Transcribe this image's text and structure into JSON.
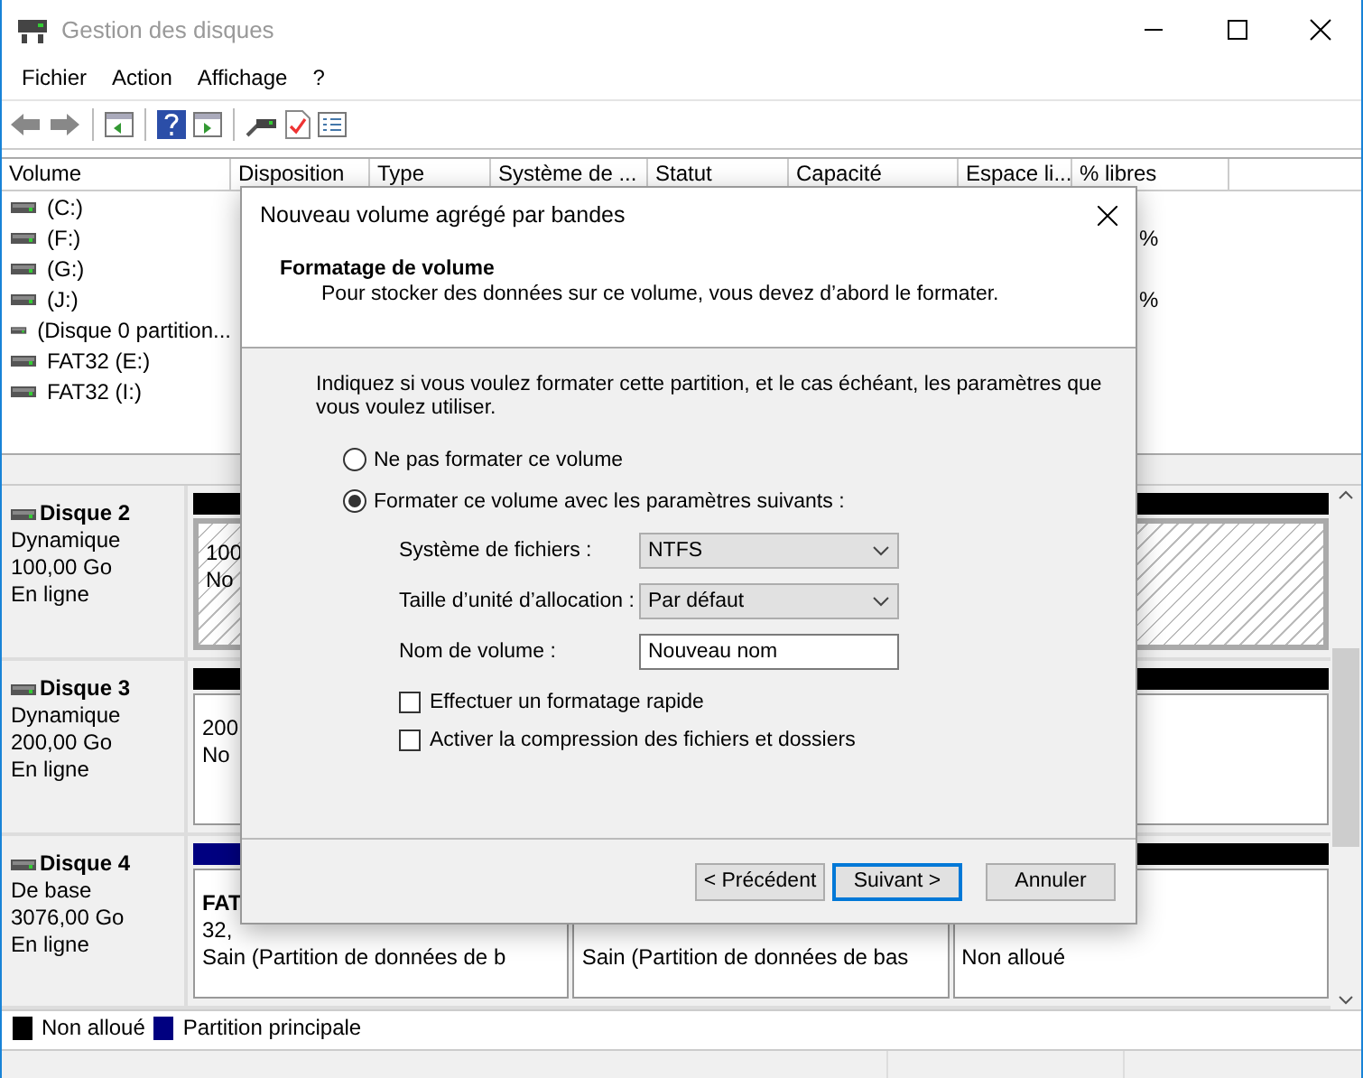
{
  "window": {
    "title": "Gestion des disques"
  },
  "menu": [
    "Fichier",
    "Action",
    "Affichage",
    "?"
  ],
  "volume_table": {
    "columns": [
      "Volume",
      "Disposition",
      "Type",
      "Système de ...",
      "Statut",
      "Capacité",
      "Espace li...",
      "% libres"
    ],
    "rows": [
      {
        "volume": "(C:)"
      },
      {
        "volume": "(F:)",
        "column_8": "%"
      },
      {
        "volume": "(G:)"
      },
      {
        "volume": "(J:)",
        "column_8": "%"
      },
      {
        "volume": "(Disque 0 partition..."
      },
      {
        "volume": "FAT32 (E:)"
      },
      {
        "volume": "FAT32 (I:)"
      }
    ]
  },
  "disks": [
    {
      "name": "Disque 2",
      "type": "Dynamique",
      "size": "100,00 Go",
      "status": "En ligne",
      "partitions": [
        {
          "kind": "unallocated",
          "selected": true,
          "lines": [
            "100",
            "No"
          ]
        }
      ]
    },
    {
      "name": "Disque 3",
      "type": "Dynamique",
      "size": "200,00 Go",
      "status": "En ligne",
      "partitions": [
        {
          "kind": "unallocated",
          "selected": false,
          "lines": [
            "200",
            "No"
          ]
        }
      ]
    },
    {
      "name": "Disque 4",
      "type": "De base",
      "size": "3076,00 Go",
      "status": "En ligne",
      "partitions": [
        {
          "kind": "primary",
          "selected": false,
          "name": "FAT",
          "lines": [
            "32,",
            "Sain (Partition de données de b"
          ]
        },
        {
          "selected": false,
          "lines": [
            "Sain (Partition de données de bas"
          ]
        },
        {
          "kind": "unallocated",
          "selected": false,
          "lines": [
            "Non alloué"
          ]
        }
      ]
    }
  ],
  "legend": [
    {
      "label": "Non alloué",
      "color": "#000000"
    },
    {
      "label": "Partition principale",
      "color": "#000080"
    }
  ],
  "dialog": {
    "title": "Nouveau volume agrégé par bandes",
    "heading": "Formatage de volume",
    "subheading": "Pour stocker des données sur ce volume, vous devez d’abord le formater.",
    "intro": "Indiquez si vous voulez formater cette partition, et le cas échéant, les paramètres que vous voulez utiliser.",
    "options": [
      {
        "label": "Ne pas formater ce volume",
        "selected": false
      },
      {
        "label": "Formater ce volume avec les paramètres suivants :",
        "selected": true
      }
    ],
    "fields": [
      {
        "label": "Système de fichiers :",
        "kind": "select",
        "value": "NTFS"
      },
      {
        "label": "Taille d’unité d’allocation :",
        "kind": "select",
        "value": "Par défaut"
      },
      {
        "label": "Nom de volume :",
        "kind": "text",
        "value": "Nouveau nom"
      }
    ],
    "checkboxes": [
      {
        "label": "Effectuer un formatage rapide",
        "checked": false
      },
      {
        "label": "Activer la compression des fichiers et dossiers",
        "checked": false
      }
    ],
    "buttons": [
      {
        "label": "< Précédent",
        "focused": false
      },
      {
        "label": "Suivant >",
        "focused": true
      },
      {
        "label": "Annuler",
        "focused": false
      }
    ]
  }
}
